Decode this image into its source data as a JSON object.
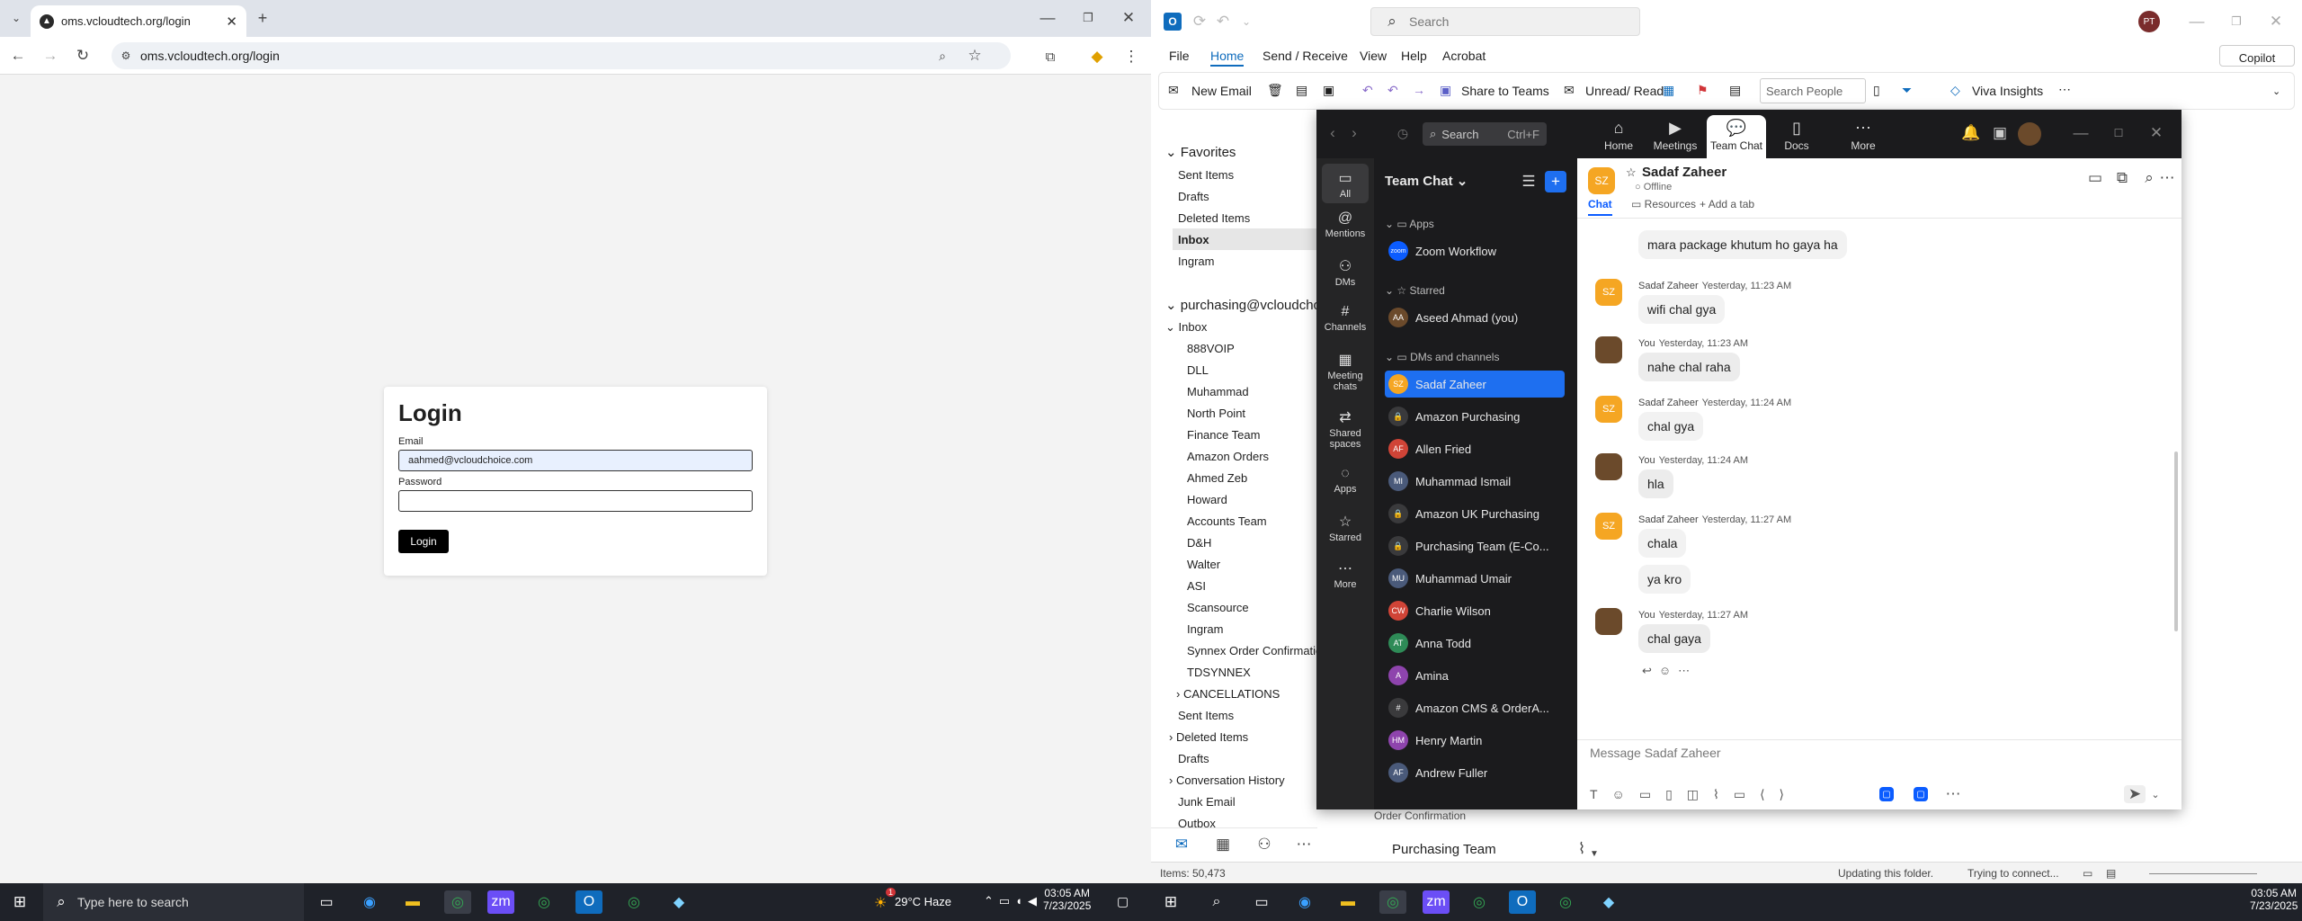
{
  "browser": {
    "tab_title": "oms.vcloudtech.org/login",
    "url": "oms.vcloudtech.org/login"
  },
  "login": {
    "title": "Login",
    "email_label": "Email",
    "email_value": "aahmed@vcloudchoice.com",
    "password_label": "Password",
    "button": "Login"
  },
  "taskbar": {
    "search_placeholder": "Type here to search",
    "weather": "29°C Haze",
    "time": "03:05 AM",
    "date": "7/23/2025",
    "weather_badge": "1"
  },
  "outlook": {
    "search_placeholder": "Search",
    "avatar": "PT",
    "copilot": "Copilot",
    "menu": [
      "File",
      "Home",
      "Send / Receive",
      "View",
      "Help",
      "Acrobat"
    ],
    "ribbon": {
      "new_email": "New Email",
      "share_teams": "Share to Teams",
      "unread_read": "Unread/ Read",
      "search_people": "Search People",
      "viva": "Viva Insights"
    },
    "favorites_label": "Favorites",
    "favorites": [
      "Sent Items",
      "Drafts",
      "Deleted Items",
      "Inbox",
      "Ingram"
    ],
    "account": "purchasing@vcloudcho",
    "inbox_label": "Inbox",
    "inbox_folders": [
      "888VOIP",
      "DLL",
      "Muhammad",
      "North Point",
      "Finance Team",
      "Amazon Orders",
      "Ahmed Zeb",
      "Howard",
      "Accounts Team",
      "D&H",
      "Walter",
      "ASI",
      "Scansource",
      "Ingram",
      "Synnex Order Confirmation",
      "TDSYNNEX"
    ],
    "more_folders": [
      "CANCELLATIONS",
      "Sent Items",
      "Deleted Items",
      "Drafts",
      "Conversation History",
      "Junk Email",
      "Outbox"
    ],
    "list_item_1": "Order Confirmation",
    "list_item_2": "Purchasing Team",
    "status": {
      "items": "Items: 50,473",
      "updating": "Updating this folder.",
      "connect": "Trying to connect..."
    }
  },
  "teams": {
    "search": "Search",
    "search_shortcut": "Ctrl+F",
    "top_nav": [
      "Home",
      "Meetings",
      "Team Chat",
      "Docs",
      "More"
    ],
    "rail": [
      "All",
      "Mentions",
      "DMs",
      "Channels",
      "Meeting chats",
      "Shared spaces",
      "Apps",
      "Starred",
      "More"
    ],
    "list_title": "Team Chat",
    "sections": {
      "apps": "Apps",
      "starred": "Starred",
      "dms": "DMs and channels"
    },
    "apps": [
      {
        "name": "Zoom Workflow",
        "initials": "zoom",
        "color": "#0b5cff"
      }
    ],
    "starred": [
      {
        "name": "Aseed Ahmad (you)",
        "initials": "AA",
        "color": "#6b4a2b"
      }
    ],
    "dms": [
      {
        "name": "Sadaf Zaheer",
        "initials": "SZ",
        "color": "#f5a623"
      },
      {
        "name": "Amazon Purchasing",
        "initials": "🔒",
        "color": "#3a3a3c"
      },
      {
        "name": "Allen Fried",
        "initials": "AF",
        "color": "#d04437"
      },
      {
        "name": "Muhammad Ismail",
        "initials": "MI",
        "color": "#4a5a7a"
      },
      {
        "name": "Amazon UK Purchasing",
        "initials": "🔒",
        "color": "#3a3a3c"
      },
      {
        "name": "Purchasing Team (E-Co...",
        "initials": "🔒",
        "color": "#3a3a3c"
      },
      {
        "name": "Muhammad Umair",
        "initials": "MU",
        "color": "#4a5a7a"
      },
      {
        "name": "Charlie Wilson",
        "initials": "CW",
        "color": "#d04437"
      },
      {
        "name": "Anna Todd",
        "initials": "AT",
        "color": "#2e8b57"
      },
      {
        "name": "Amina",
        "initials": "A",
        "color": "#8e44ad"
      },
      {
        "name": "Amazon CMS & OrderA...",
        "initials": "#",
        "color": "#3a3a3c"
      },
      {
        "name": "Henry Martin",
        "initials": "HM",
        "color": "#8e44ad"
      },
      {
        "name": "Andrew Fuller",
        "initials": "AF",
        "color": "#4a5a7a"
      }
    ],
    "chat": {
      "name": "Sadaf Zaheer",
      "initials": "SZ",
      "status": "Offline",
      "tabs": [
        "Chat",
        "Resources",
        "Add a tab"
      ],
      "compose_placeholder": "Message Sadaf Zaheer",
      "messages": [
        {
          "text": "mara package khutum ho gaya ha"
        },
        {
          "sender": "Sadaf Zaheer",
          "time": "Yesterday, 11:23 AM",
          "text": "wifi chal gya",
          "who": "sz"
        },
        {
          "sender": "You",
          "time": "Yesterday, 11:23 AM",
          "text": "nahe chal raha",
          "who": "me"
        },
        {
          "sender": "Sadaf Zaheer",
          "time": "Yesterday, 11:24 AM",
          "text": "chal gya",
          "who": "sz"
        },
        {
          "sender": "You",
          "time": "Yesterday, 11:24 AM",
          "text": "hla",
          "who": "me"
        },
        {
          "sender": "Sadaf Zaheer",
          "time": "Yesterday, 11:27 AM",
          "text": "chala",
          "who": "sz"
        },
        {
          "text": "ya kro",
          "who": "sz2"
        },
        {
          "sender": "You",
          "time": "Yesterday, 11:27 AM",
          "text": "chal gaya",
          "who": "me"
        }
      ]
    }
  }
}
